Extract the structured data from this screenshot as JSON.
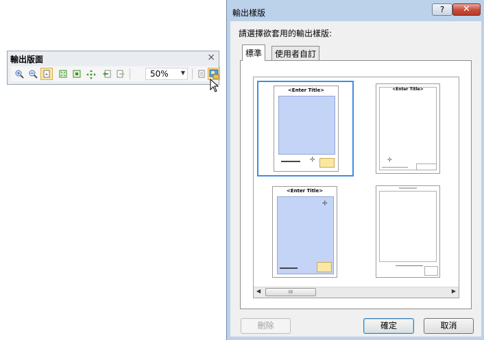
{
  "toolbar": {
    "title": "輸出版面",
    "close_glyph": "×",
    "zoom_value": "50%",
    "buttons": [
      {
        "name": "zoom-in-icon"
      },
      {
        "name": "zoom-out-icon"
      },
      {
        "name": "pan-icon",
        "active": true
      },
      {
        "name": "zoom-whole-page-icon"
      },
      {
        "name": "zoom-100-percent-icon"
      },
      {
        "name": "pan-arrows-icon"
      },
      {
        "name": "go-back-icon"
      },
      {
        "name": "go-forward-icon"
      },
      {
        "name": "toggle-draft-mode-icon"
      },
      {
        "name": "change-layout-icon",
        "active": true
      }
    ]
  },
  "dialog": {
    "title": "輸出樣版",
    "help_glyph": "?",
    "close_glyph": "✕",
    "prompt": "請選擇欲套用的輸出樣版:",
    "tabs": [
      {
        "label": "標準",
        "selected": true
      },
      {
        "label": "使用者自訂",
        "selected": false
      }
    ],
    "templates": [
      {
        "title": "<Enter Title>",
        "selected": true
      },
      {
        "title": "<Enter Title>",
        "selected": false
      },
      {
        "title": "<Enter Title>",
        "selected": false
      },
      {
        "title": "",
        "selected": false
      }
    ],
    "scroll_thumb_glyph": "III",
    "delete_label": "刪除",
    "ok_label": "確定",
    "cancel_label": "取消"
  },
  "colors": {
    "dialog_frame": "#bcd2ea",
    "selection_border": "#3c8ede",
    "map_frame": "#c3d4f7",
    "legend": "#fbe6a2",
    "close_button": "#c94a39"
  }
}
